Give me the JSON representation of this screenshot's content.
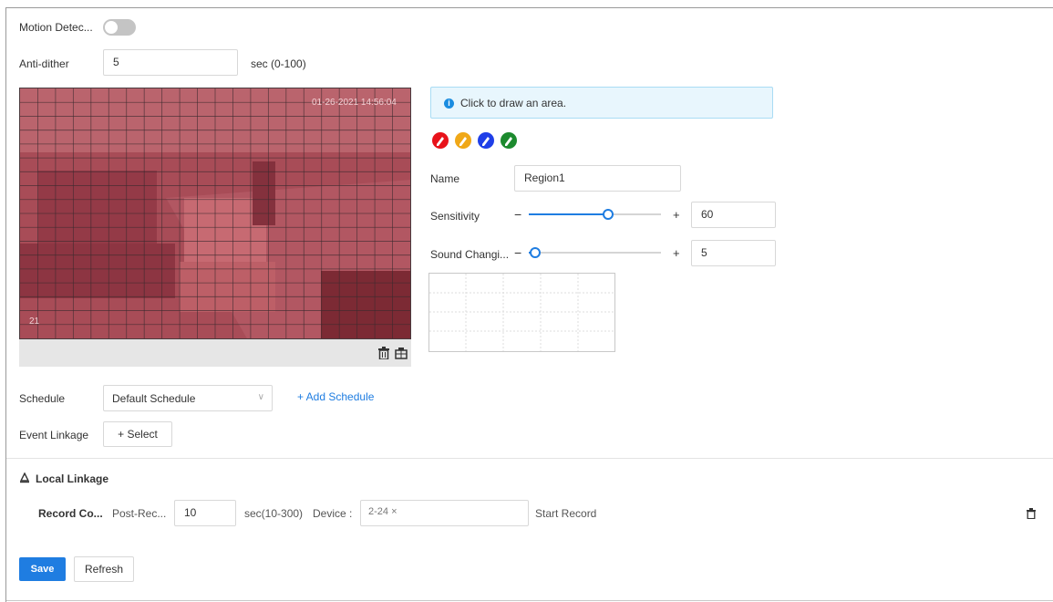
{
  "motion_detection": {
    "label": "Motion Detec...",
    "enabled": false
  },
  "anti_dither": {
    "label": "Anti-dither",
    "value": "5",
    "unit": "sec (0-100)"
  },
  "video": {
    "timestamp": "01-26-2021 14:56:04",
    "channel_label": "21"
  },
  "info": {
    "message": "Click to draw an area."
  },
  "region_pens": [
    {
      "name": "region1-pen",
      "color": "#e8121a"
    },
    {
      "name": "region2-pen",
      "color": "#f0a818"
    },
    {
      "name": "region3-pen",
      "color": "#1f3fe8"
    },
    {
      "name": "region4-pen",
      "color": "#1c8a2e"
    }
  ],
  "name_field": {
    "label": "Name",
    "value": "Region1"
  },
  "sensitivity": {
    "label": "Sensitivity",
    "minus": "−",
    "plus": "+",
    "value": "60",
    "level_fraction": 0.6
  },
  "sound_change": {
    "label": "Sound Changi...",
    "minus": "−",
    "plus": "+",
    "value": "5",
    "level_fraction": 0.05
  },
  "schedule": {
    "label": "Schedule",
    "value": "Default Schedule",
    "add_label": "+ Add Schedule"
  },
  "event_linkage": {
    "label": "Event Linkage",
    "select_label": "+ Select"
  },
  "local_linkage": {
    "title": "Local Linkage",
    "row": {
      "name": "Record Co...",
      "post_record_label": "Post-Rec...",
      "post_record_value": "10",
      "post_record_unit": "sec(10-300)",
      "device_label": "Device :",
      "device_tag": "2-24 ×",
      "action": "Start Record"
    }
  },
  "actions": {
    "save": "Save",
    "refresh": "Refresh"
  },
  "colors": {
    "accent": "#1f7de1",
    "info_bg": "#e8f6fd",
    "overlay": "#c8283a"
  }
}
